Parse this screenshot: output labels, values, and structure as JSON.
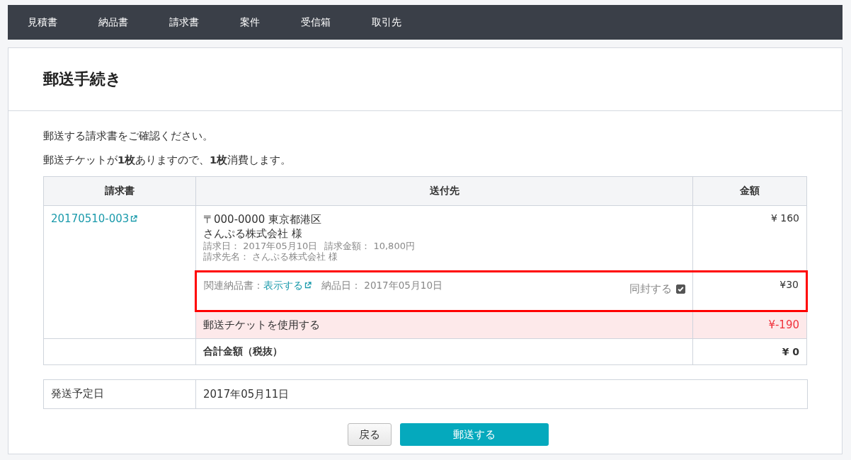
{
  "nav": [
    {
      "label": "見積書"
    },
    {
      "label": "納品書"
    },
    {
      "label": "請求書"
    },
    {
      "label": "案件"
    },
    {
      "label": "受信箱"
    },
    {
      "label": "取引先"
    }
  ],
  "page_title": "郵送手続き",
  "messages": [
    "郵送する請求書をご確認ください。",
    "郵送チケットが**1枚**ありますので、**1枚**消費します。"
  ],
  "table": {
    "columns": [
      "請求書",
      "送付先",
      "金額"
    ],
    "invoice": {
      "number": "20170510-003",
      "address": "〒000-0000 東京都港区",
      "recipient": "さんぷる株式会社 様",
      "detail_lines": [
        [
          "請求日： 2017年05月10日",
          "請求金額： 10,800円"
        ],
        [
          "請求先名： さんぷる株式会社 様"
        ]
      ],
      "amount": "¥ 160"
    },
    "delivery_note": {
      "label": "関連納品書：",
      "link": "表示する",
      "date": "納品日： 2017年05月10日",
      "enclose_label": "同封する",
      "enclose_checked": true,
      "highlighted": true,
      "amount": "¥30"
    },
    "ticket": {
      "label": "郵送チケットを使用する",
      "amount": "¥-190"
    },
    "total": {
      "label": "合計金額（税抜）",
      "amount": "¥ 0"
    }
  },
  "ship_date": {
    "label": "発送予定日",
    "value": "2017年05月11日"
  },
  "buttons": [
    {
      "label": "戻る",
      "kind": "secondary"
    },
    {
      "label": "郵送する",
      "kind": "primary"
    }
  ]
}
